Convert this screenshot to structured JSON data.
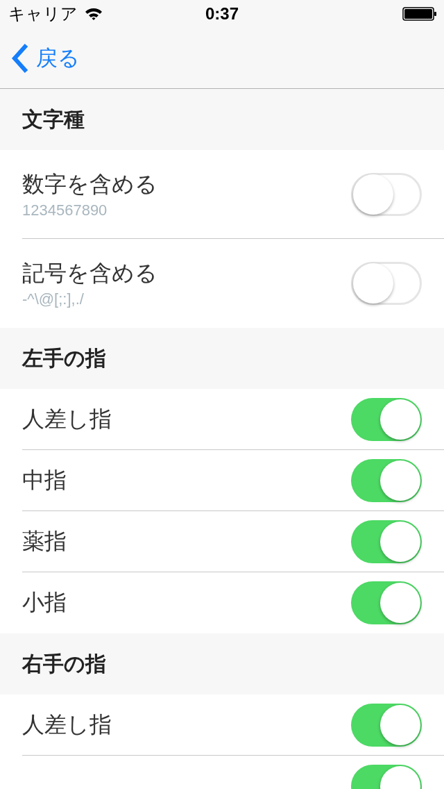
{
  "status_bar": {
    "carrier": "キャリア",
    "time": "0:37"
  },
  "nav": {
    "back": "戻る"
  },
  "sections": [
    {
      "title": "文字種",
      "rows": [
        {
          "label": "数字を含める",
          "subtitle": "1234567890",
          "on": false
        },
        {
          "label": "記号を含める",
          "subtitle": "-^\\@[;:],./",
          "on": false
        }
      ]
    },
    {
      "title": "左手の指",
      "rows": [
        {
          "label": "人差し指",
          "on": true
        },
        {
          "label": "中指",
          "on": true
        },
        {
          "label": "薬指",
          "on": true
        },
        {
          "label": "小指",
          "on": true
        }
      ]
    },
    {
      "title": "右手の指",
      "rows": [
        {
          "label": "人差し指",
          "on": true
        },
        {
          "on": true
        }
      ]
    }
  ]
}
